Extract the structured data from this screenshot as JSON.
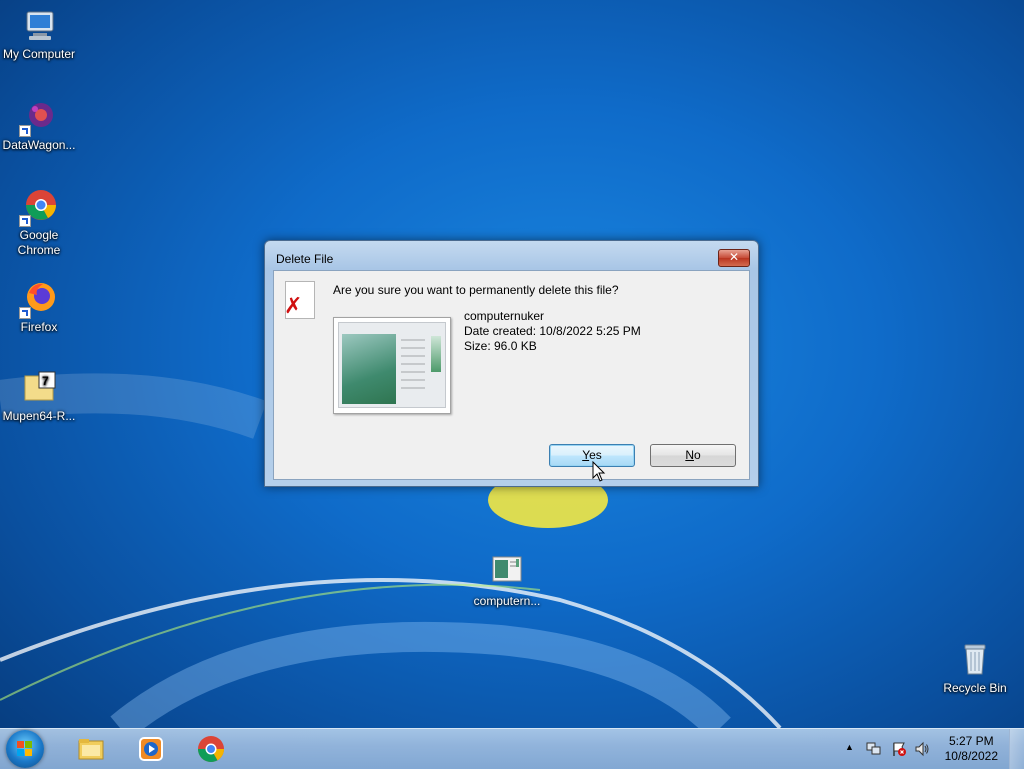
{
  "desktop": {
    "icons": [
      {
        "label": "My Computer"
      },
      {
        "label": "DataWagon..."
      },
      {
        "label": "Google Chrome"
      },
      {
        "label": "Firefox"
      },
      {
        "label": "Mupen64-R..."
      },
      {
        "label": "computern..."
      },
      {
        "label": "Recycle Bin"
      }
    ]
  },
  "dialog": {
    "title": "Delete File",
    "close_label": "✕",
    "question": "Are you sure you want to permanently delete this file?",
    "file_name": "computernuker",
    "date_created": "Date created: 10/8/2022 5:25 PM",
    "size": "Size: 96.0 KB",
    "yes_label": "Yes",
    "no_label": "No"
  },
  "taskbar": {
    "pinned": [
      "Windows Explorer",
      "Windows Media Player",
      "Google Chrome"
    ],
    "clock_time": "5:27 PM",
    "clock_date": "10/8/2022",
    "tray_arrow": "▲"
  }
}
